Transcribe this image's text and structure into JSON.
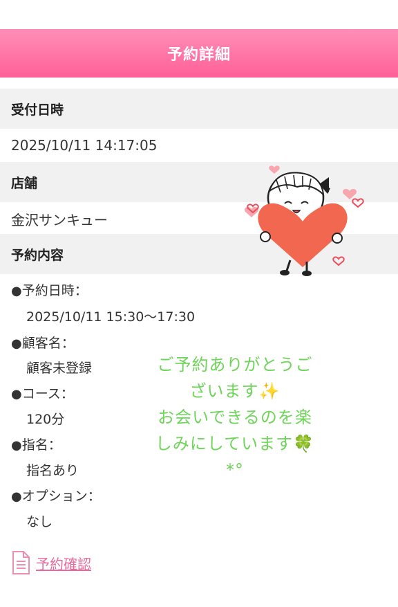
{
  "header": {
    "title": "予約詳細"
  },
  "reception": {
    "label": "受付日時",
    "value": "2025/10/11 14:17:05"
  },
  "store": {
    "label": "店舗",
    "value": "金沢サンキュー"
  },
  "reservation": {
    "label": "予約内容",
    "bullet": "●",
    "items": [
      {
        "label": "予約日時：",
        "value": "2025/10/11 15:30〜17:30"
      },
      {
        "label": "顧客名：",
        "value": "顧客未登録"
      },
      {
        "label": "コース：",
        "value": "120分"
      },
      {
        "label": "指名：",
        "value": "指名あり"
      },
      {
        "label": "オプション：",
        "value": "なし"
      }
    ]
  },
  "overlay_message": {
    "lines": [
      "ご予約ありがとうご",
      "ざいます✨",
      "お会いできるのを楽",
      "しみにしています🍀",
      "*°"
    ]
  },
  "confirm_link": {
    "label": "予約確認",
    "icon": "document-icon"
  },
  "colors": {
    "header": "#ff6fa2",
    "link": "#e86a9c",
    "message": "#6fd45a",
    "heart": "#f2674f"
  }
}
